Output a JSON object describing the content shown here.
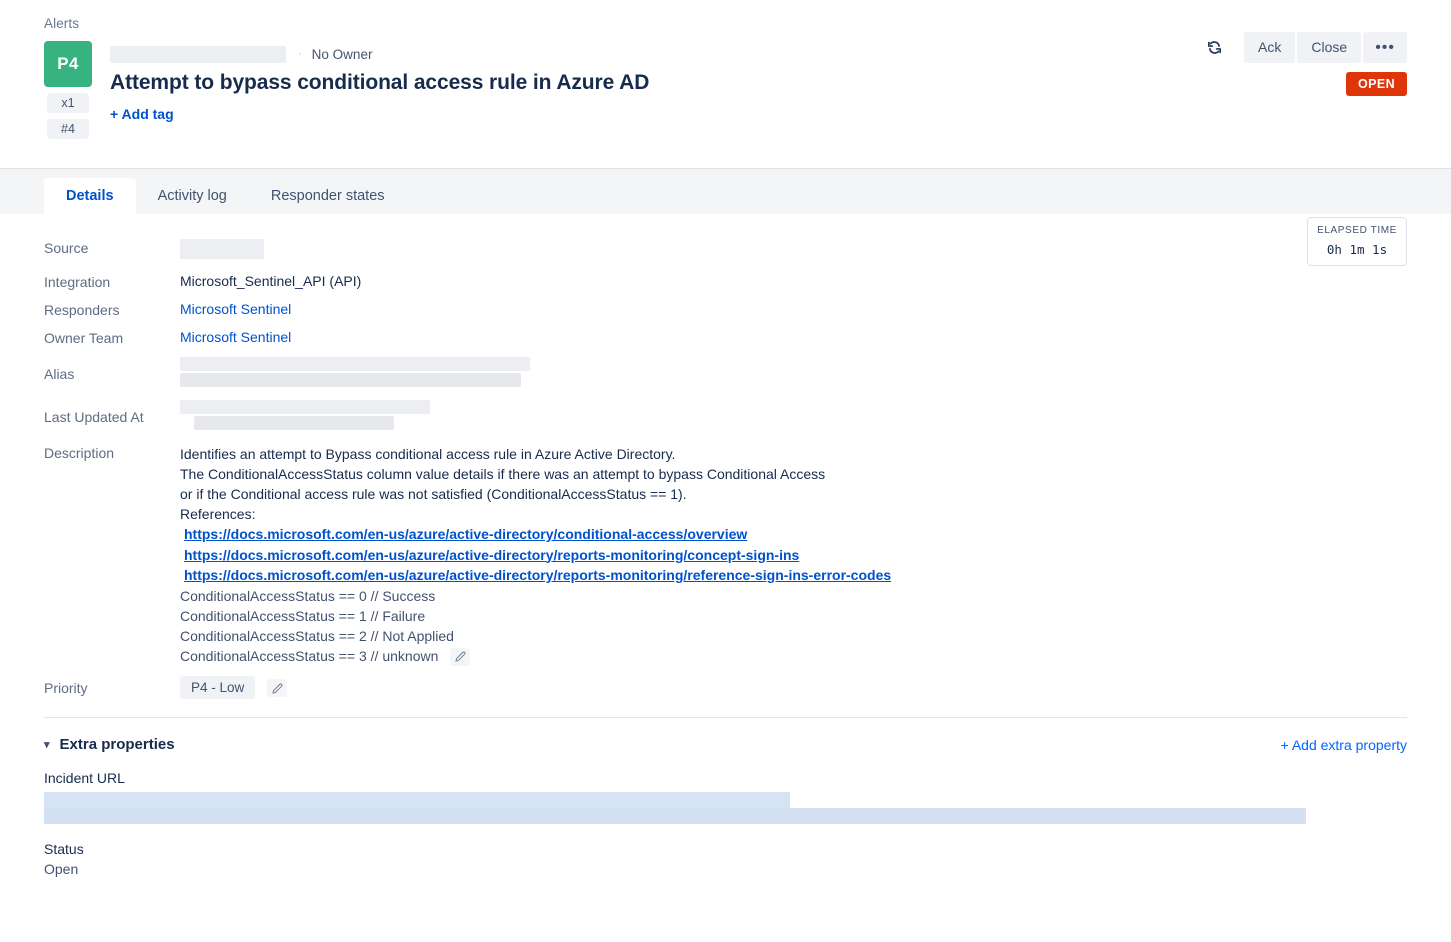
{
  "header": {
    "breadcrumb": "Alerts",
    "priority_badge": "P4",
    "count_chip": "x1",
    "number_chip": "#4",
    "owner": "No Owner",
    "meta_separator": "·",
    "title": "Attempt to bypass conditional access rule in Azure AD",
    "add_tag": "+ Add tag",
    "refresh_icon": "refresh-icon",
    "ack_label": "Ack",
    "close_label": "Close",
    "more_label": "•••",
    "status_pill": "OPEN",
    "badge_color": "#36b37e",
    "status_color": "#de350b"
  },
  "tabs": [
    {
      "label": "Details",
      "active": true
    },
    {
      "label": "Activity log",
      "active": false
    },
    {
      "label": "Responder states",
      "active": false
    }
  ],
  "details": {
    "labels": {
      "source": "Source",
      "integration": "Integration",
      "responders": "Responders",
      "owner_team": "Owner Team",
      "alias": "Alias",
      "last_updated": "Last Updated At",
      "description": "Description",
      "priority": "Priority"
    },
    "values": {
      "source": "",
      "integration": "Microsoft_Sentinel_API (API)",
      "responders": "Microsoft Sentinel",
      "owner_team": "Microsoft Sentinel",
      "alias": "",
      "last_updated": "",
      "priority": "P4 - Low"
    },
    "description": {
      "lines": [
        "Identifies an attempt to Bypass conditional access rule in Azure Active Directory.",
        "The ConditionalAccessStatus column value details if there was an attempt to bypass Conditional Access",
        "or if the Conditional access rule was not satisfied (ConditionalAccessStatus == 1).",
        "References:"
      ],
      "references": [
        "https://docs.microsoft.com/en-us/azure/active-directory/conditional-access/overview",
        "https://docs.microsoft.com/en-us/azure/active-directory/reports-monitoring/concept-sign-ins",
        "https://docs.microsoft.com/en-us/azure/active-directory/reports-monitoring/reference-sign-ins-error-codes"
      ],
      "status_codes": [
        "ConditionalAccessStatus == 0 // Success",
        "ConditionalAccessStatus == 1 // Failure",
        "ConditionalAccessStatus == 2 // Not Applied",
        "ConditionalAccessStatus == 3 // unknown"
      ]
    }
  },
  "elapsed": {
    "title": "ELAPSED TIME",
    "value": "0h 1m  1s"
  },
  "extra_properties": {
    "section_title": "Extra properties",
    "caret_icon": "chevron-down-icon",
    "add_label": "+ Add extra property",
    "properties": [
      {
        "name": "Incident URL",
        "value": ""
      },
      {
        "name": "Status",
        "value": "Open"
      }
    ]
  }
}
